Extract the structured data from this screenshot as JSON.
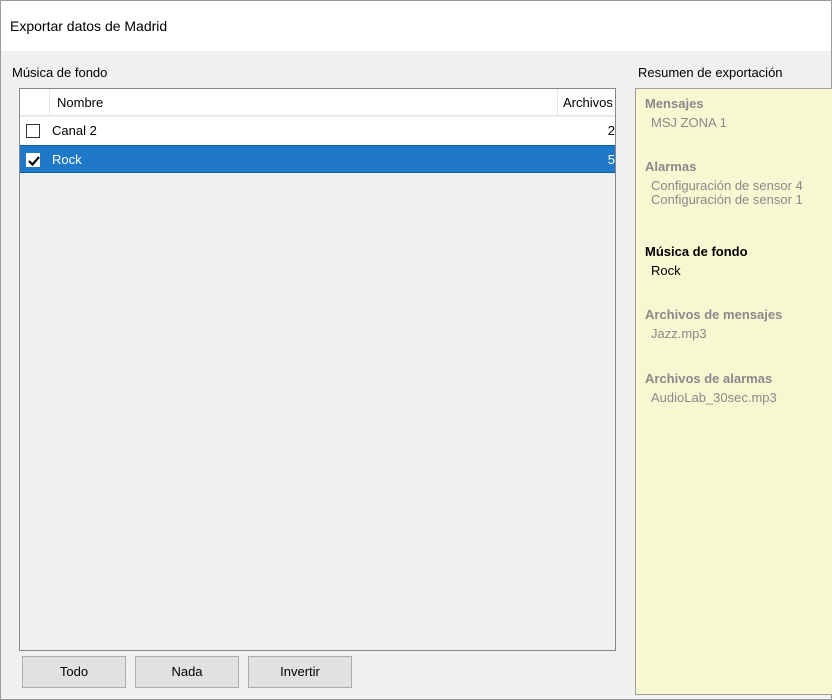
{
  "window": {
    "title": "Exportar datos de Madrid"
  },
  "background_music": {
    "label": "Música de fondo",
    "columns": {
      "name": "Nombre",
      "files": "Archivos"
    },
    "rows": [
      {
        "name": "Canal 2",
        "files": "2",
        "checked": false,
        "selected": false
      },
      {
        "name": "Rock",
        "files": "5",
        "checked": true,
        "selected": true
      }
    ]
  },
  "buttons": {
    "all": "Todo",
    "none": "Nada",
    "invert": "Invertir"
  },
  "summary": {
    "label": "Resumen de exportación",
    "groups": [
      {
        "title": "Mensajes",
        "items": [
          "MSJ ZONA 1"
        ]
      },
      {
        "title": "Alarmas",
        "items": [
          "Configuración de sensor 4",
          "Configuración de sensor 1"
        ]
      },
      {
        "title": "Música de fondo",
        "items": [
          "Rock"
        ]
      },
      {
        "title": "Archivos de mensajes",
        "items": [
          "Jazz.mp3"
        ]
      },
      {
        "title": "Archivos de alarmas",
        "items": [
          "AudioLab_30sec.mp3"
        ]
      }
    ]
  },
  "colors": {
    "selection": "#1f79c8",
    "summary_background": "#f7f7d2",
    "inactive_text": "#8a8a8a"
  }
}
